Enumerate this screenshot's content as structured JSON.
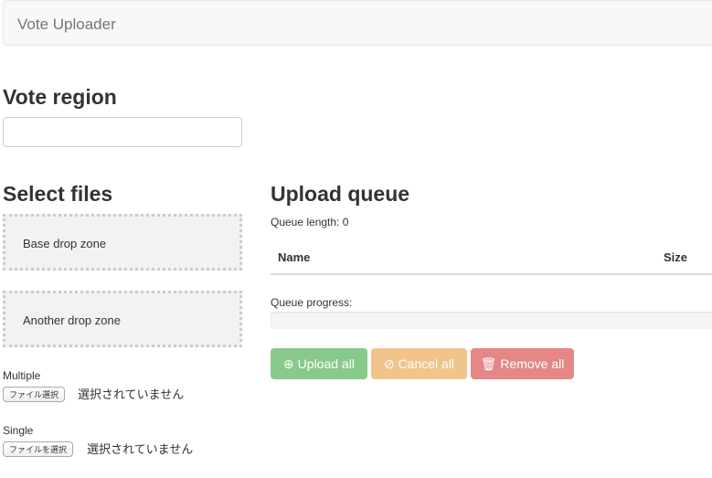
{
  "navbar": {
    "brand": "Vote Uploader"
  },
  "vote_region": {
    "title": "Vote region",
    "value": ""
  },
  "select_files": {
    "title": "Select files",
    "base_drop": "Base drop zone",
    "another_drop": "Another drop zone",
    "multiple": {
      "label": "Multiple",
      "button": "ファイル選択",
      "status": "選択されていません"
    },
    "single": {
      "label": "Single",
      "button": "ファイルを選択",
      "status": "選択されていません"
    }
  },
  "queue": {
    "title": "Upload queue",
    "length_label": "Queue length: 0",
    "columns": [
      "Name",
      "Size"
    ],
    "progress_label": "Queue progress:",
    "progress": 0,
    "buttons": {
      "upload": "Upload all",
      "cancel": "Cancel all",
      "remove": "Remove all"
    }
  },
  "colors": {
    "success": "#89c98b",
    "warning": "#f1c48b",
    "danger": "#e38886"
  }
}
